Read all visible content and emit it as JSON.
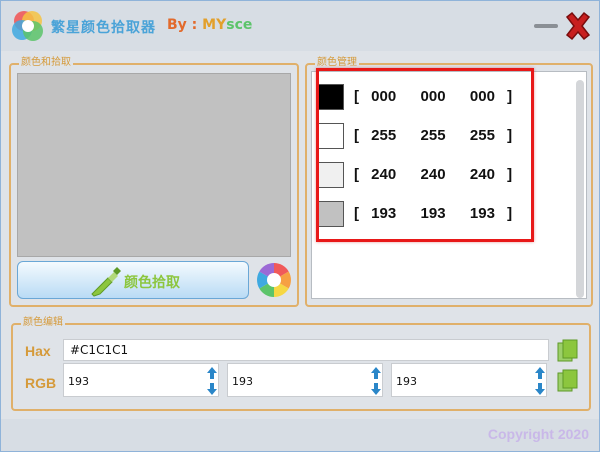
{
  "app": {
    "title": "繁星颜色拾取器",
    "author_prefix": "By : ",
    "author_my": "MY",
    "author_sce": "sce"
  },
  "pick_panel": {
    "label": "颜色和拾取",
    "preview_color": "#C1C1C1",
    "pick_button_label": "颜色拾取"
  },
  "manage_panel": {
    "label": "颜色管理",
    "swatches": [
      {
        "color": "#000000",
        "text": "[ 000  000  000 ]"
      },
      {
        "color": "#FFFFFF",
        "text": "[ 255  255  255 ]"
      },
      {
        "color": "#F0F0F0",
        "text": "[ 240  240  240 ]"
      },
      {
        "color": "#C1C1C1",
        "text": "[ 193  193  193 ]"
      }
    ]
  },
  "edit_panel": {
    "label": "颜色编辑",
    "hex_label": "Hax",
    "hex_value": "#C1C1C1",
    "rgb_label": "RGB",
    "r": "193",
    "g": "193",
    "b": "193"
  },
  "status": {
    "copyright": "Copyright 2020"
  },
  "colors": {
    "accent_orange": "#E0B06A",
    "highlight_red": "#E81818",
    "button_green": "#8CC63E"
  }
}
